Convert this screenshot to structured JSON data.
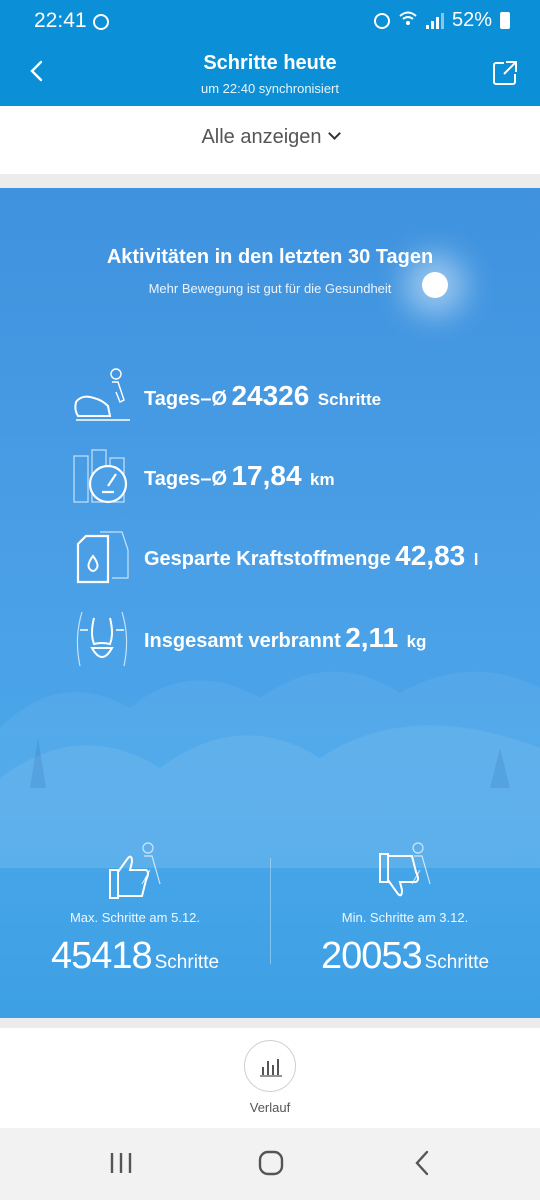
{
  "status_bar": {
    "time": "22:41",
    "battery": "52%"
  },
  "app_bar": {
    "title": "Schritte heute",
    "subtitle": "um 22:40 synchronisiert"
  },
  "filter": {
    "label": "Alle anzeigen"
  },
  "summary": {
    "heading": "Aktivitäten in den letzten 30 Tagen",
    "subheading": "Mehr Bewegung ist gut für die Gesundheit",
    "stats": [
      {
        "icon": "shoe-walker-icon",
        "label": "Tages–Ø",
        "value": "24326",
        "unit": "Schritte"
      },
      {
        "icon": "speedometer-city-icon",
        "label": "Tages–Ø",
        "value": "17,84",
        "unit": "km"
      },
      {
        "icon": "fuel-can-car-icon",
        "label": "Gesparte Kraftstoffmenge",
        "value": "42,83",
        "unit": "l"
      },
      {
        "icon": "body-waist-icon",
        "label": "Insgesamt verbrannt",
        "value": "2,11",
        "unit": "kg"
      }
    ],
    "max": {
      "icon": "thumbs-up-walker-icon",
      "label": "Max. Schritte am 5.12.",
      "value": "45418",
      "unit": "Schritte"
    },
    "min": {
      "icon": "thumbs-down-walker-icon",
      "label": "Min. Schritte am 3.12.",
      "value": "20053",
      "unit": "Schritte"
    }
  },
  "bottom_bar": {
    "history_label": "Verlauf",
    "history_icon": "bar-chart-icon"
  },
  "nav_bar": {
    "icons": [
      "recents-icon",
      "home-icon",
      "back-icon"
    ]
  },
  "colors": {
    "primary": "#0b8fd6",
    "panel": "#4a9fe6"
  }
}
